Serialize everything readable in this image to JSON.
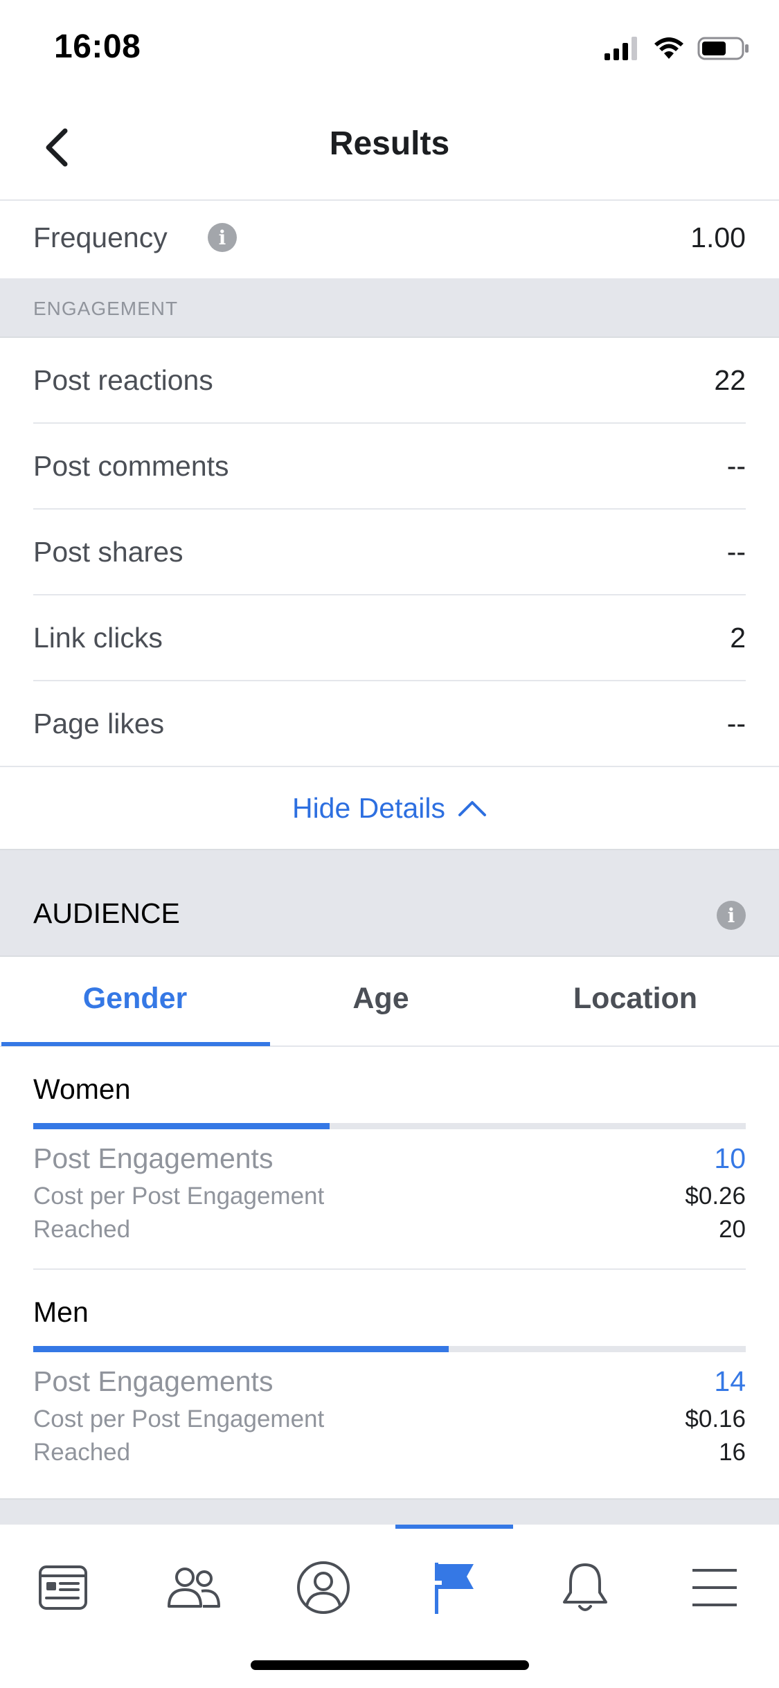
{
  "status_bar": {
    "time": "16:08"
  },
  "nav": {
    "title": "Results"
  },
  "frequency": {
    "label": "Frequency",
    "value": "1.00"
  },
  "engagement": {
    "section_title": "ENGAGEMENT",
    "rows": [
      {
        "label": "Post reactions",
        "value": "22"
      },
      {
        "label": "Post comments",
        "value": "--"
      },
      {
        "label": "Post shares",
        "value": "--"
      },
      {
        "label": "Link clicks",
        "value": "2"
      },
      {
        "label": "Page likes",
        "value": "--"
      }
    ]
  },
  "hide_details": {
    "label": "Hide Details"
  },
  "audience": {
    "title": "AUDIENCE",
    "tabs": [
      {
        "label": "Gender",
        "active": true
      },
      {
        "label": "Age",
        "active": false
      },
      {
        "label": "Location",
        "active": false
      }
    ],
    "groups": [
      {
        "name": "Women",
        "share": 0.416,
        "post_engagements_label": "Post Engagements",
        "post_engagements": "10",
        "cost_label": "Cost per Post Engagement",
        "cost": "$0.26",
        "reached_label": "Reached",
        "reached": "20"
      },
      {
        "name": "Men",
        "share": 0.583,
        "post_engagements_label": "Post Engagements",
        "post_engagements": "14",
        "cost_label": "Cost per Post Engagement",
        "cost": "$0.16",
        "reached_label": "Reached",
        "reached": "16"
      }
    ]
  },
  "tab_bar": {
    "items": [
      {
        "icon": "news-feed-icon",
        "active": false
      },
      {
        "icon": "friends-icon",
        "active": false
      },
      {
        "icon": "profile-icon",
        "active": false
      },
      {
        "icon": "pages-flag-icon",
        "active": true
      },
      {
        "icon": "notifications-bell-icon",
        "active": false
      },
      {
        "icon": "menu-icon",
        "active": false
      }
    ]
  },
  "colors": {
    "accent": "#3578e5",
    "band": "#e4e6eb",
    "muted": "#90949c"
  }
}
